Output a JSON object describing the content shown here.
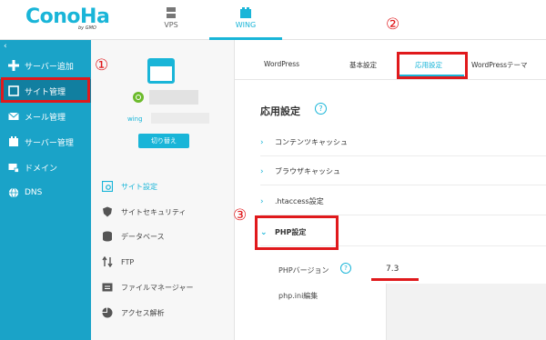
{
  "header": {
    "logo_text": "ConoHa",
    "logo_sub": "by GMO",
    "nav": [
      {
        "label": "VPS",
        "icon": "server-icon"
      },
      {
        "label": "WING",
        "icon": "wing-icon",
        "active": true
      }
    ]
  },
  "sidebar": {
    "collapse": "‹",
    "items": [
      {
        "label": "サーバー追加",
        "icon": "plus-icon"
      },
      {
        "label": "サイト管理",
        "icon": "site-icon",
        "active": true
      },
      {
        "label": "メール管理",
        "icon": "mail-icon"
      },
      {
        "label": "サーバー管理",
        "icon": "server-icon"
      },
      {
        "label": "ドメイン",
        "icon": "domain-icon"
      },
      {
        "label": "DNS",
        "icon": "globe-icon"
      }
    ]
  },
  "site_panel": {
    "wing_prefix": "wing",
    "switch_button": "切り替え",
    "menu": [
      {
        "label": "サイト設定",
        "icon": "gear-icon",
        "active": true
      },
      {
        "label": "サイトセキュリティ",
        "icon": "shield-icon"
      },
      {
        "label": "データベース",
        "icon": "database-icon"
      },
      {
        "label": "FTP",
        "icon": "transfer-icon"
      },
      {
        "label": "ファイルマネージャー",
        "icon": "folder-icon"
      },
      {
        "label": "アクセス解析",
        "icon": "pie-chart-icon"
      }
    ]
  },
  "tabs": [
    {
      "label": "WordPress"
    },
    {
      "label": "基本設定"
    },
    {
      "label": "応用設定",
      "active": true
    },
    {
      "label": "WordPressテーマ"
    }
  ],
  "main": {
    "title": "応用設定",
    "help": "?",
    "sections": [
      {
        "label": "コンテンツキャッシュ",
        "chevron": "›"
      },
      {
        "label": "ブラウザキャッシュ",
        "chevron": "›"
      },
      {
        "label": ".htaccess設定",
        "chevron": "›"
      },
      {
        "label": "PHP設定",
        "chevron": "⌄",
        "open": true
      }
    ],
    "php_version_label": "PHPバージョン",
    "php_version_value": "7.3",
    "php_ini_label": "php.ini編集"
  },
  "annotations": {
    "step1": "①",
    "step2": "②",
    "step3": "③"
  },
  "colors": {
    "accent": "#19b5d8",
    "sidebar": "#1aa3c8",
    "sidebar_active": "#117fa0",
    "highlight": "#e0191c"
  }
}
